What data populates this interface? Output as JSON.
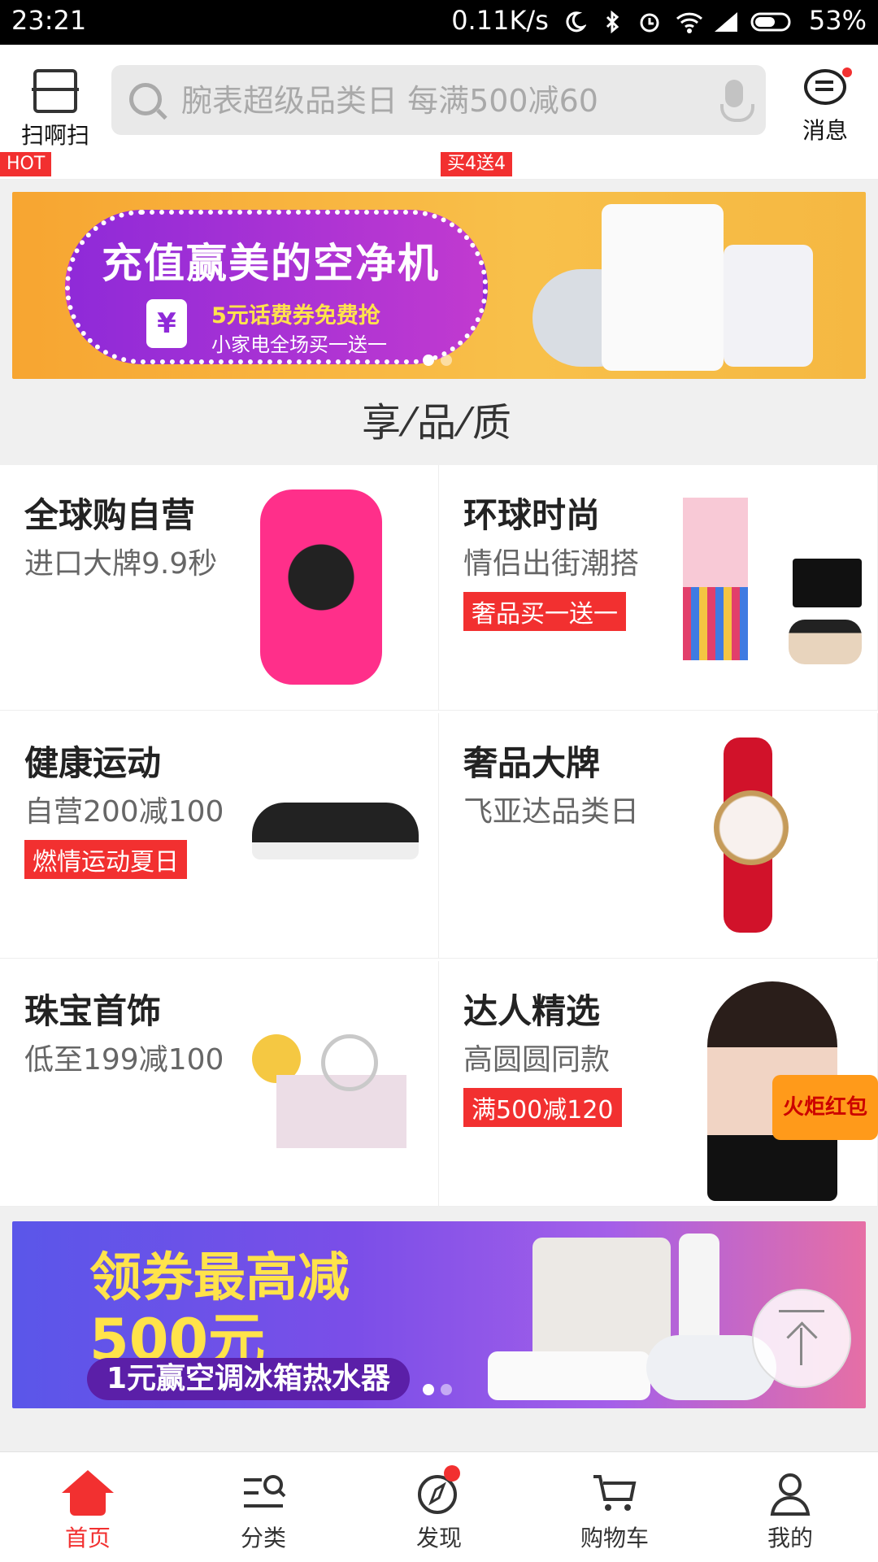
{
  "status_bar": {
    "time": "23:21",
    "network_speed": "0.11K/s",
    "battery": "53%",
    "icons": [
      "moon-icon",
      "bluetooth-icon",
      "alarm-icon",
      "wifi-icon",
      "signal-icon",
      "battery-icon"
    ]
  },
  "header": {
    "scan_label": "扫啊扫",
    "search_placeholder": "腕表超级品类日 每满500减60",
    "message_label": "消息"
  },
  "strip": {
    "hot_badge": "HOT",
    "promo_badge": "买4送4"
  },
  "banner1": {
    "title": "充值赢美的空净机",
    "subtitle": "5元话费券免费抢",
    "subtitle2": "小家电全场买一送一",
    "phone_symbol": "¥",
    "dots": [
      true,
      false
    ]
  },
  "section": {
    "title": "享⁄品⁄质"
  },
  "grid": [
    {
      "title": "全球购自营",
      "subtitle": "进口大牌9.9秒",
      "tag": ""
    },
    {
      "title": "环球时尚",
      "subtitle": "情侣出街潮搭",
      "tag": "奢品买一送一"
    },
    {
      "title": "健康运动",
      "subtitle": "自营200减100",
      "tag": "燃情运动夏日"
    },
    {
      "title": "奢品大牌",
      "subtitle": "飞亚达品类日",
      "tag": ""
    },
    {
      "title": "珠宝首饰",
      "subtitle": "低至199减100",
      "tag": ""
    },
    {
      "title": "达人精选",
      "subtitle": "高圆圆同款",
      "tag": "满500减120"
    }
  ],
  "promo_sticker": "火炬红包",
  "banner2": {
    "line1": "领券最高减",
    "line2": "500元",
    "pill": "1元赢空调冰箱热水器",
    "dots": [
      true,
      false
    ]
  },
  "tabbar": [
    {
      "label": "首页",
      "active": true
    },
    {
      "label": "分类",
      "active": false
    },
    {
      "label": "发现",
      "active": false
    },
    {
      "label": "购物车",
      "active": false
    },
    {
      "label": "我的",
      "active": false
    }
  ],
  "colors": {
    "accent": "#f23030",
    "banner1_bg": "#f7b33f",
    "banner2_bg": "#6f52e8"
  }
}
